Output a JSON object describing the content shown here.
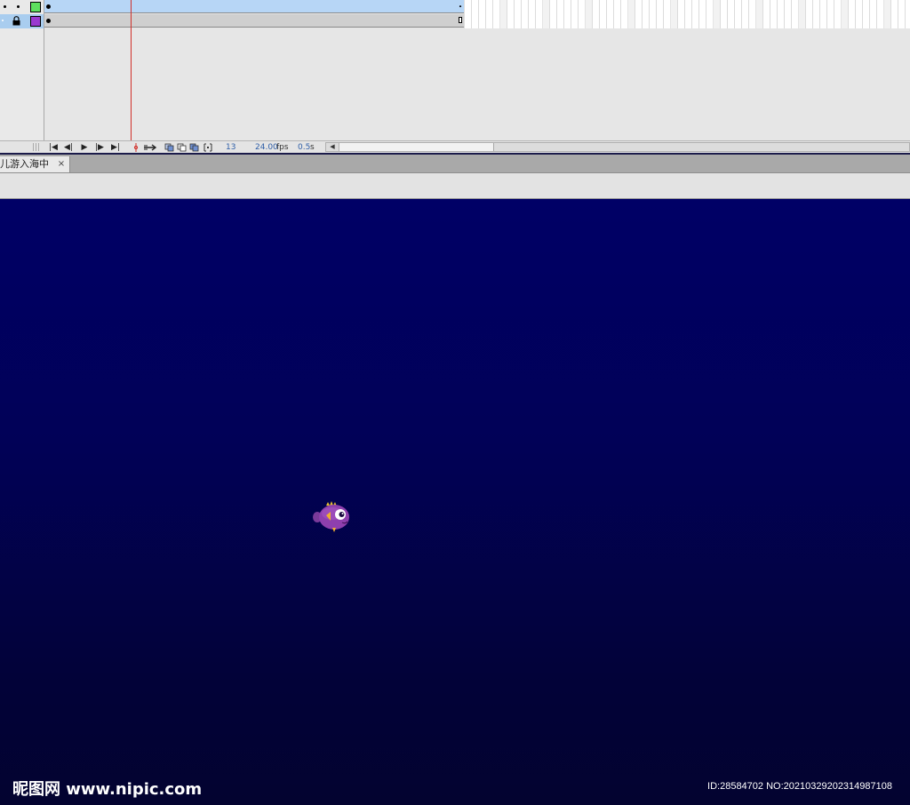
{
  "timeline": {
    "controls": {
      "current_frame": "13",
      "fps_value": "24.00",
      "fps_unit": "fps",
      "time_value": "0.5",
      "time_unit": "s",
      "first_frame_glyph": "|◀",
      "step_back_glyph": "◀|",
      "play_glyph": "▶",
      "step_forward_glyph": "|▶",
      "last_frame_glyph": "▶|",
      "scroll_left_glyph": "◀"
    },
    "layers": [
      {
        "swatch_color": "#5ee05e"
      },
      {
        "swatch_color": "#9a3ad0"
      }
    ],
    "playhead_color": "#d0302a"
  },
  "document_tab": {
    "label": "儿游入海中",
    "close_glyph": "×"
  },
  "stage": {
    "background_top": "#000066",
    "background_bottom": "#030330"
  },
  "watermark": {
    "logo_text": "昵图网 www.nipic.com",
    "id_text": "ID:28584702 NO:20210329202314987108"
  }
}
